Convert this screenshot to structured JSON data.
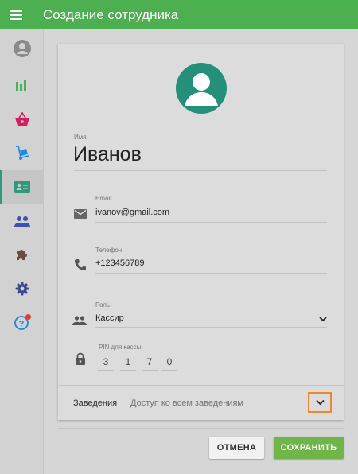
{
  "appbar": {
    "title": "Создание сотрудника",
    "menu_icon": "menu-icon",
    "color": "#4caf50"
  },
  "sidebar": {
    "items": [
      {
        "name": "profile",
        "icon": "account-circle-icon",
        "color": "#8a8a8a"
      },
      {
        "name": "reports",
        "icon": "bar-chart-icon",
        "color": "#4caf50"
      },
      {
        "name": "sales",
        "icon": "basket-icon",
        "color": "#d81b60"
      },
      {
        "name": "delivery",
        "icon": "hand-truck-icon",
        "color": "#1e88e5"
      },
      {
        "name": "employees",
        "icon": "id-card-icon",
        "color": "#2e9a7d",
        "active": true
      },
      {
        "name": "customers",
        "icon": "people-icon",
        "color": "#3f51b5"
      },
      {
        "name": "integrations",
        "icon": "puzzle-icon",
        "color": "#6d4c41"
      },
      {
        "name": "settings",
        "icon": "gear-icon",
        "color": "#3c4a96"
      },
      {
        "name": "help",
        "icon": "help-icon",
        "color": "#1e88e5",
        "badge": true
      }
    ]
  },
  "form": {
    "name_label": "Имя",
    "name_value": "Иванов",
    "email_label": "Email",
    "email_value": "ivanov@gmail.com",
    "phone_label": "Телефон",
    "phone_value": "+123456789",
    "role_label": "Роль",
    "role_value": "Кассир",
    "pin_label": "PIN для кассы",
    "pin_digits": [
      "3",
      "1",
      "7",
      "0"
    ],
    "venues_label": "Заведения",
    "venues_value": "Доступ ко всем заведениям"
  },
  "actions": {
    "cancel_label": "ОТМЕНА",
    "save_label": "СОХРАНИТЬ"
  },
  "colors": {
    "accent": "#2e9a7d",
    "save_button": "#6fb548",
    "highlight": "#f0872f"
  }
}
